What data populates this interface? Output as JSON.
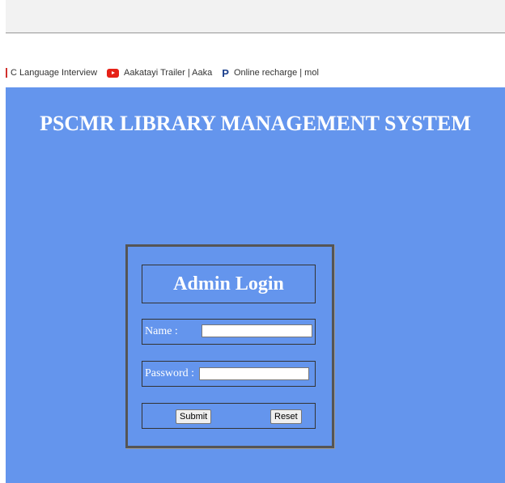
{
  "bookmarks": [
    {
      "label": "C Language Interview",
      "icon": "bookmark-icon"
    },
    {
      "label": "Aakatayi Trailer | Aaka",
      "icon": "youtube-icon"
    },
    {
      "label": "Online recharge | mol",
      "icon": "paytm-icon"
    }
  ],
  "page": {
    "title": "PSCMR LIBRARY MANAGEMENT SYSTEM",
    "background": "#6495ed"
  },
  "login": {
    "heading": "Admin Login",
    "name_label": "Name :",
    "name_value": "",
    "password_label": "Password :",
    "password_value": "",
    "submit_label": "Submit",
    "reset_label": "Reset"
  }
}
